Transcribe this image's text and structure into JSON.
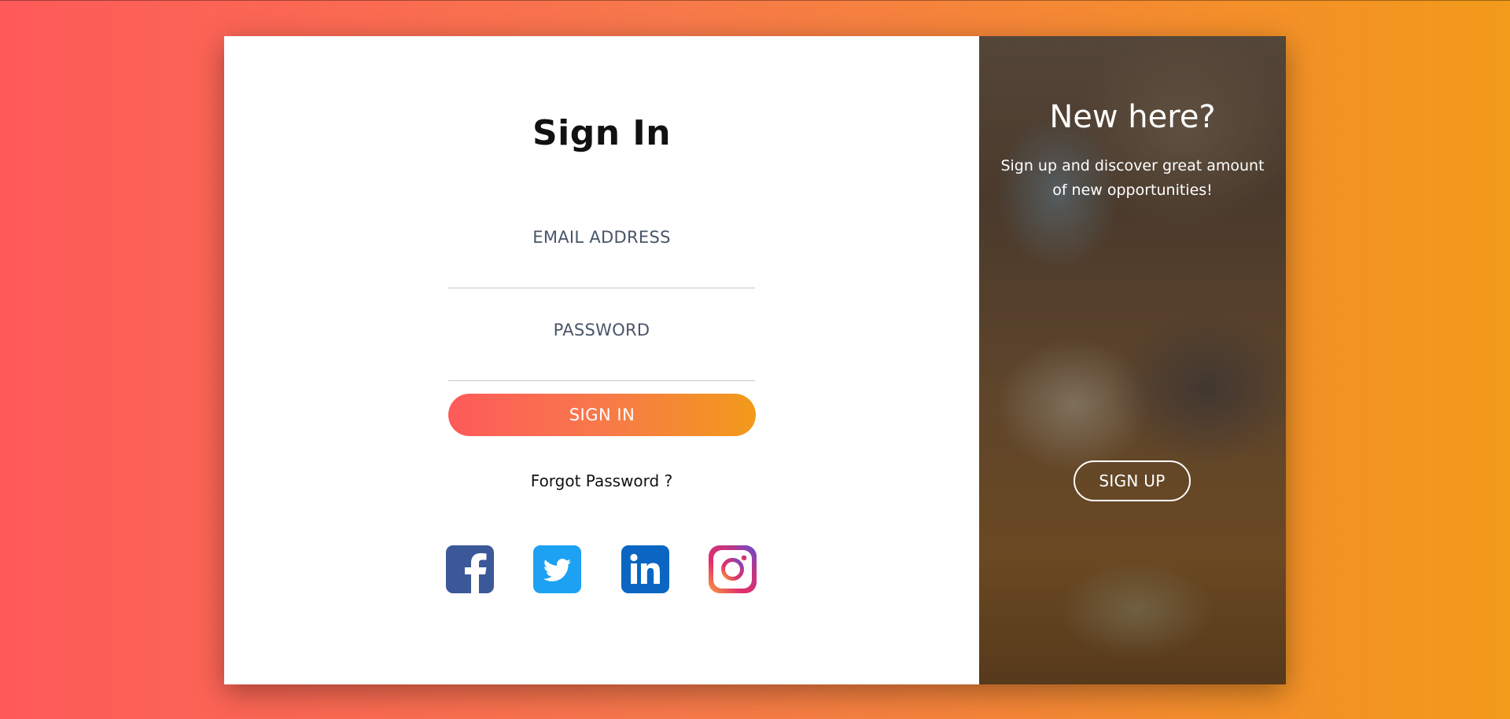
{
  "signin": {
    "title": "Sign In",
    "email_label": "EMAIL ADDRESS",
    "email_value": "",
    "password_label": "PASSWORD",
    "password_value": "",
    "button_label": "SIGN IN",
    "forgot_label": "Forgot Password ?"
  },
  "social": [
    {
      "icon": "facebook-icon",
      "color": "#3b5998"
    },
    {
      "icon": "twitter-icon",
      "color": "#1da1f2"
    },
    {
      "icon": "linkedin-icon",
      "color": "#0a66c2"
    },
    {
      "icon": "instagram-icon",
      "color": "#c13584"
    }
  ],
  "promo": {
    "title": "New here?",
    "subtitle": "Sign up and discover great amount of new opportunities!",
    "button_label": "SIGN UP"
  },
  "colors": {
    "gradient_start": "#fe5a5a",
    "gradient_end": "#f29a1a"
  }
}
